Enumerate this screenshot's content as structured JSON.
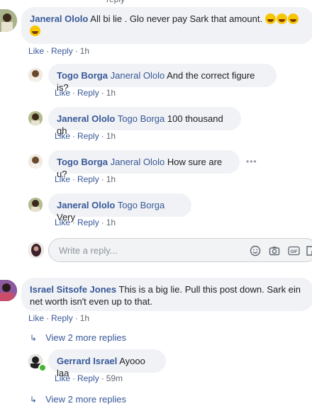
{
  "top_partial": {
    "text": "reply"
  },
  "actions": {
    "like": "Like",
    "reply": "Reply"
  },
  "comments": [
    {
      "author": "Janeral Ololo",
      "tag": "",
      "text": "All bi lie . Glo never pay Sark that amount.",
      "time": "1h"
    },
    {
      "author": "Togo Borga",
      "tag": "Janeral Ololo",
      "text": "And the correct figure is?",
      "time": "1h"
    },
    {
      "author": "Janeral Ololo",
      "tag": "Togo Borga",
      "text": "100 thousand gh",
      "time": "1h"
    },
    {
      "author": "Togo Borga",
      "tag": "Janeral Ololo",
      "text": "How sure are u?",
      "time": "1h"
    },
    {
      "author": "Janeral Ololo",
      "tag": "Togo Borga",
      "text": "Very",
      "time": "1h"
    },
    {
      "author": "Israel Sitsofe Jones",
      "tag": "",
      "text_line1": "This is a big lie. Pull this post down. Sark ein",
      "text_line2": "net worth isn't even up to that.",
      "time": "1h"
    },
    {
      "author": "Gerrard Israel",
      "tag": "",
      "text": "Ayooo laa",
      "time": "59m"
    }
  ],
  "reply_box": {
    "placeholder": "Write a reply..."
  },
  "view_more": [
    "View 2 more replies",
    "View 2 more replies"
  ],
  "icons": {
    "emoji": "laughing-emoji-icon",
    "smile": "smile-icon",
    "camera": "camera-icon",
    "gif": "gif-icon",
    "sticker": "sticker-icon",
    "dots": "more-dots-icon",
    "arrow": "reply-arrow-icon"
  },
  "colors": {
    "link": "#385898",
    "bubble": "#f0f2f5",
    "meta": "#606770",
    "emoji": "#f7c600"
  }
}
